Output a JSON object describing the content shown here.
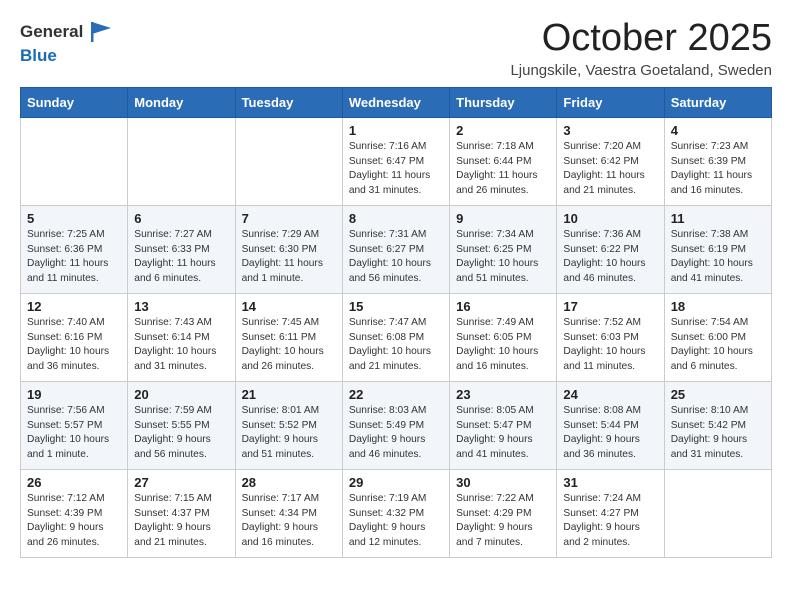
{
  "logo": {
    "general": "General",
    "blue": "Blue"
  },
  "header": {
    "month": "October 2025",
    "location": "Ljungskile, Vaestra Goetaland, Sweden"
  },
  "weekdays": [
    "Sunday",
    "Monday",
    "Tuesday",
    "Wednesday",
    "Thursday",
    "Friday",
    "Saturday"
  ],
  "weeks": [
    [
      {
        "day": "",
        "info": ""
      },
      {
        "day": "",
        "info": ""
      },
      {
        "day": "",
        "info": ""
      },
      {
        "day": "1",
        "info": "Sunrise: 7:16 AM\nSunset: 6:47 PM\nDaylight: 11 hours\nand 31 minutes."
      },
      {
        "day": "2",
        "info": "Sunrise: 7:18 AM\nSunset: 6:44 PM\nDaylight: 11 hours\nand 26 minutes."
      },
      {
        "day": "3",
        "info": "Sunrise: 7:20 AM\nSunset: 6:42 PM\nDaylight: 11 hours\nand 21 minutes."
      },
      {
        "day": "4",
        "info": "Sunrise: 7:23 AM\nSunset: 6:39 PM\nDaylight: 11 hours\nand 16 minutes."
      }
    ],
    [
      {
        "day": "5",
        "info": "Sunrise: 7:25 AM\nSunset: 6:36 PM\nDaylight: 11 hours\nand 11 minutes."
      },
      {
        "day": "6",
        "info": "Sunrise: 7:27 AM\nSunset: 6:33 PM\nDaylight: 11 hours\nand 6 minutes."
      },
      {
        "day": "7",
        "info": "Sunrise: 7:29 AM\nSunset: 6:30 PM\nDaylight: 11 hours\nand 1 minute."
      },
      {
        "day": "8",
        "info": "Sunrise: 7:31 AM\nSunset: 6:27 PM\nDaylight: 10 hours\nand 56 minutes."
      },
      {
        "day": "9",
        "info": "Sunrise: 7:34 AM\nSunset: 6:25 PM\nDaylight: 10 hours\nand 51 minutes."
      },
      {
        "day": "10",
        "info": "Sunrise: 7:36 AM\nSunset: 6:22 PM\nDaylight: 10 hours\nand 46 minutes."
      },
      {
        "day": "11",
        "info": "Sunrise: 7:38 AM\nSunset: 6:19 PM\nDaylight: 10 hours\nand 41 minutes."
      }
    ],
    [
      {
        "day": "12",
        "info": "Sunrise: 7:40 AM\nSunset: 6:16 PM\nDaylight: 10 hours\nand 36 minutes."
      },
      {
        "day": "13",
        "info": "Sunrise: 7:43 AM\nSunset: 6:14 PM\nDaylight: 10 hours\nand 31 minutes."
      },
      {
        "day": "14",
        "info": "Sunrise: 7:45 AM\nSunset: 6:11 PM\nDaylight: 10 hours\nand 26 minutes."
      },
      {
        "day": "15",
        "info": "Sunrise: 7:47 AM\nSunset: 6:08 PM\nDaylight: 10 hours\nand 21 minutes."
      },
      {
        "day": "16",
        "info": "Sunrise: 7:49 AM\nSunset: 6:05 PM\nDaylight: 10 hours\nand 16 minutes."
      },
      {
        "day": "17",
        "info": "Sunrise: 7:52 AM\nSunset: 6:03 PM\nDaylight: 10 hours\nand 11 minutes."
      },
      {
        "day": "18",
        "info": "Sunrise: 7:54 AM\nSunset: 6:00 PM\nDaylight: 10 hours\nand 6 minutes."
      }
    ],
    [
      {
        "day": "19",
        "info": "Sunrise: 7:56 AM\nSunset: 5:57 PM\nDaylight: 10 hours\nand 1 minute."
      },
      {
        "day": "20",
        "info": "Sunrise: 7:59 AM\nSunset: 5:55 PM\nDaylight: 9 hours\nand 56 minutes."
      },
      {
        "day": "21",
        "info": "Sunrise: 8:01 AM\nSunset: 5:52 PM\nDaylight: 9 hours\nand 51 minutes."
      },
      {
        "day": "22",
        "info": "Sunrise: 8:03 AM\nSunset: 5:49 PM\nDaylight: 9 hours\nand 46 minutes."
      },
      {
        "day": "23",
        "info": "Sunrise: 8:05 AM\nSunset: 5:47 PM\nDaylight: 9 hours\nand 41 minutes."
      },
      {
        "day": "24",
        "info": "Sunrise: 8:08 AM\nSunset: 5:44 PM\nDaylight: 9 hours\nand 36 minutes."
      },
      {
        "day": "25",
        "info": "Sunrise: 8:10 AM\nSunset: 5:42 PM\nDaylight: 9 hours\nand 31 minutes."
      }
    ],
    [
      {
        "day": "26",
        "info": "Sunrise: 7:12 AM\nSunset: 4:39 PM\nDaylight: 9 hours\nand 26 minutes."
      },
      {
        "day": "27",
        "info": "Sunrise: 7:15 AM\nSunset: 4:37 PM\nDaylight: 9 hours\nand 21 minutes."
      },
      {
        "day": "28",
        "info": "Sunrise: 7:17 AM\nSunset: 4:34 PM\nDaylight: 9 hours\nand 16 minutes."
      },
      {
        "day": "29",
        "info": "Sunrise: 7:19 AM\nSunset: 4:32 PM\nDaylight: 9 hours\nand 12 minutes."
      },
      {
        "day": "30",
        "info": "Sunrise: 7:22 AM\nSunset: 4:29 PM\nDaylight: 9 hours\nand 7 minutes."
      },
      {
        "day": "31",
        "info": "Sunrise: 7:24 AM\nSunset: 4:27 PM\nDaylight: 9 hours\nand 2 minutes."
      },
      {
        "day": "",
        "info": ""
      }
    ]
  ]
}
